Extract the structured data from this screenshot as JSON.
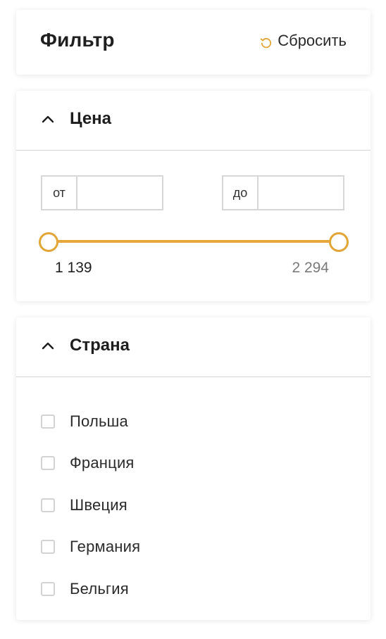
{
  "header": {
    "title": "Фильтр",
    "reset_label": "Сбросить"
  },
  "price": {
    "title": "Цена",
    "from_prefix": "от",
    "to_prefix": "до",
    "from_value": "",
    "to_value": "",
    "range_min": "1 139",
    "range_max": "2 294"
  },
  "country": {
    "title": "Страна",
    "items": [
      {
        "label": "Польша",
        "checked": false
      },
      {
        "label": "Франция",
        "checked": false
      },
      {
        "label": "Швеция",
        "checked": false
      },
      {
        "label": "Германия",
        "checked": false
      },
      {
        "label": "Бельгия",
        "checked": false
      }
    ]
  },
  "colors": {
    "accent": "#e6a83d",
    "border": "#d7d7d7",
    "text": "#1f1f1f",
    "muted": "#7a7a7a"
  },
  "icons": {
    "reset": "reset-icon",
    "section_toggle": "chevron-up-icon"
  }
}
